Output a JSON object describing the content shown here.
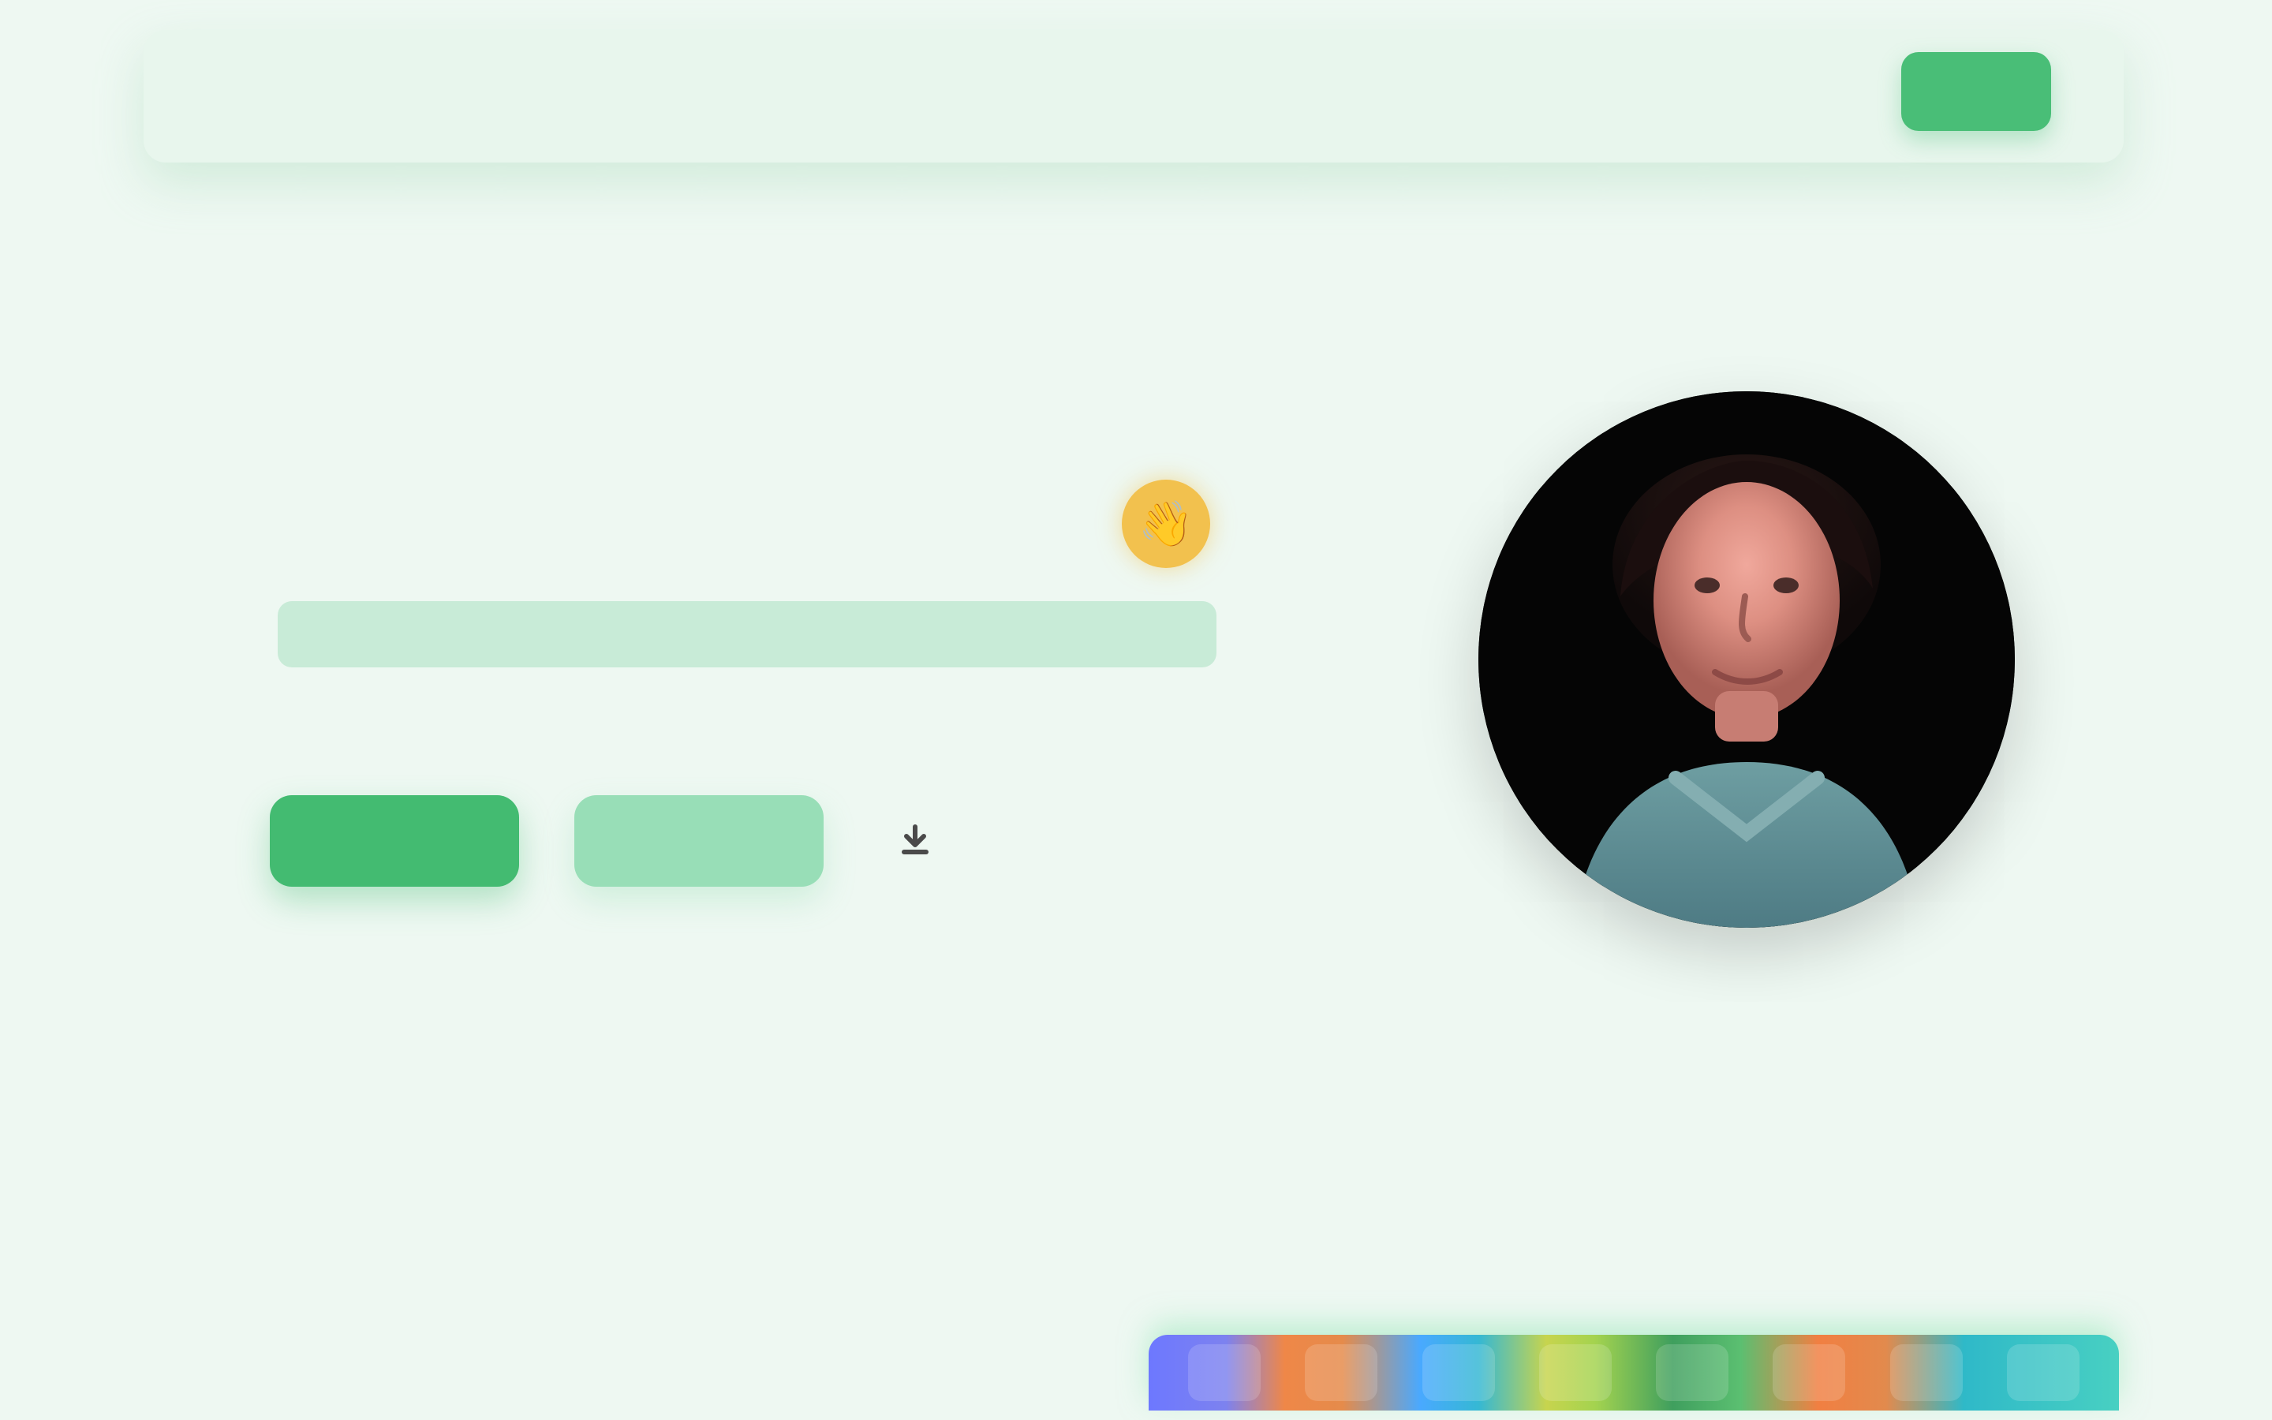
{
  "nav": {
    "brand_main": "",
    "brand_accent": "",
    "links": [
      {
        "label": ""
      },
      {
        "label": ""
      },
      {
        "label": ""
      }
    ],
    "cta_label": ""
  },
  "hero": {
    "eyebrow": "",
    "name": "",
    "wave_icon": "👋",
    "headline": "",
    "subtext": "",
    "primary_button": "",
    "secondary_button": "",
    "download_icon": "download-icon"
  },
  "about": {
    "kicker": "",
    "title_main": "",
    "title_accent": "",
    "copy": ""
  },
  "work": {
    "kicker": "",
    "title": "",
    "logos": [
      {
        "label": ""
      },
      {
        "label": ""
      },
      {
        "label": ""
      },
      {
        "label": ""
      },
      {
        "label": ""
      },
      {
        "label": ""
      },
      {
        "label": ""
      },
      {
        "label": ""
      }
    ]
  },
  "theme": {
    "page_bg": "#eef8f2",
    "accent_green": "#49be77",
    "soft_green": "#98deb7",
    "highlight_green": "#c8ebd7",
    "text_dark": "#1d1d1d",
    "badge_yellow": "#f2c14e",
    "accent_red": "#ef6a55"
  }
}
